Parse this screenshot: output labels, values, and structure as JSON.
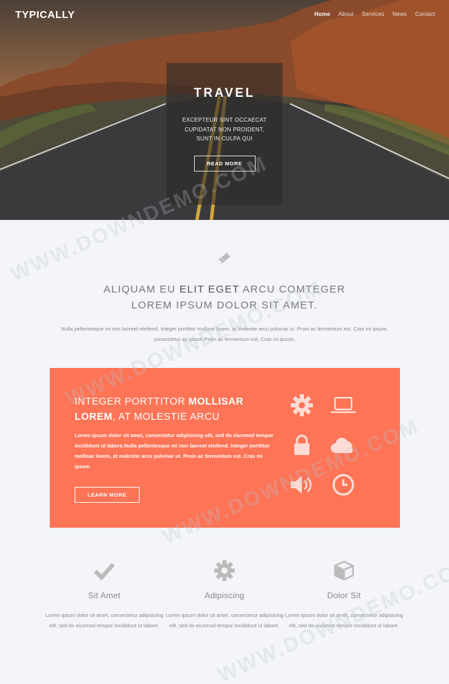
{
  "header": {
    "brand": "TYPICALLY",
    "nav": [
      "Home",
      "About",
      "Services",
      "News",
      "Contact"
    ]
  },
  "hero": {
    "title": "TRAVEL",
    "text": "EXCEPTEUR SINT OCCAECAT CUPIDATAT NON PROIDENT, SUNT IN CULPA QUI",
    "button": "READ MORE"
  },
  "intro": {
    "icon": "ticket-icon",
    "heading_pre": "ALIQUAM EU ",
    "heading_bold": "ELIT EGET",
    "heading_post": " ARCU COMTEGER",
    "heading_line2": "LOREM IPSUM DOLOR SIT AMET.",
    "paragraph": "Nulla pellentesque mi non laoreet eleifend. Integer porttitor mollisar lorem, at molestie arcu pulvinar ut. Proin ac fermentum est. Cras mi ipsum, consectetur ac ipsum Proin ac fermentum est. Cras mi ipsum."
  },
  "panel": {
    "heading_pre": "INTEGER PORTTITOR ",
    "heading_bold1": "MOLLISAR",
    "heading_bold2": "LOREM",
    "heading_post": ", AT MOLESTIE ARCU",
    "paragraph": "Lorem ipsum dolor sit amet, consectetur adipisicing elit, sed do eiusmod tempor incididunt ut labore.Nulla pellentesque mi non laoreet eleifend. Integer porttitor mollisar lorem, at molestie arcu pulvinar ut. Proin ac fermentum est. Cras mi ipsum",
    "button": "LEARN MORE",
    "icons": [
      "gear-icon",
      "laptop-icon",
      "lock-icon",
      "cloud-icon",
      "speaker-icon",
      "clock-icon"
    ],
    "color": "#fd7456"
  },
  "features": [
    {
      "icon": "check-icon",
      "title": "Sit Amet",
      "text": "Lorem ipsum dolor sit amet, consectetur adipisicing elit, sed do eiusmod tempor incididunt ut labore."
    },
    {
      "icon": "gear-icon",
      "title": "Adipiscing",
      "text": "Lorem ipsum dolor sit amet, consectetur adipisicing elit, sed do eiusmod tempor incididunt ut labore."
    },
    {
      "icon": "cube-icon",
      "title": "Dolor Sit",
      "text": "Lorem ipsum dolor sit amet, consectetur adipisicing elit, sed do eiusmod tempor incididunt ut labore."
    }
  ],
  "watermark": "WWW.DOWNDEMO.COM"
}
